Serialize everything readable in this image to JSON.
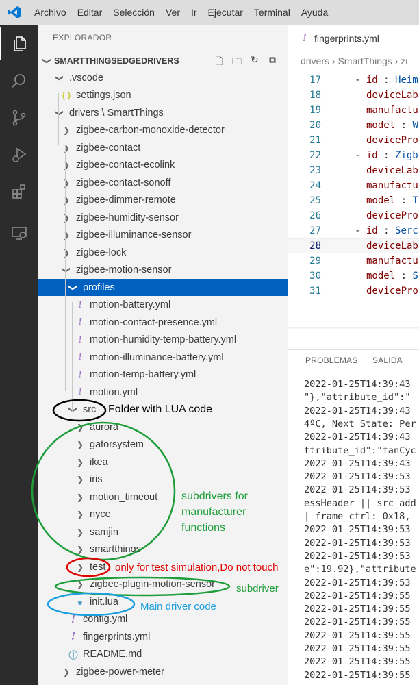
{
  "menu": {
    "items": [
      "Archivo",
      "Editar",
      "Selección",
      "Ver",
      "Ir",
      "Ejecutar",
      "Terminal",
      "Ayuda"
    ]
  },
  "activity": [
    "files-icon",
    "search-icon",
    "source-control-icon",
    "run-debug-icon",
    "extensions-icon",
    "remote-explorer-icon"
  ],
  "sidebar": {
    "title": "EXPLORADOR",
    "root": "SMARTTHINGSEDGEDRIVERS",
    "tree": [
      {
        "label": ".vscode",
        "icon": "chevron",
        "open": true,
        "indent": 1
      },
      {
        "label": "settings.json",
        "icon": "json",
        "indent": 2
      },
      {
        "label": "drivers \\ SmartThings",
        "icon": "chevron",
        "open": true,
        "indent": 1
      },
      {
        "label": "zigbee-carbon-monoxide-detector",
        "icon": "chevron",
        "indent": 2
      },
      {
        "label": "zigbee-contact",
        "icon": "chevron",
        "indent": 2
      },
      {
        "label": "zigbee-contact-ecolink",
        "icon": "chevron",
        "indent": 2
      },
      {
        "label": "zigbee-contact-sonoff",
        "icon": "chevron",
        "indent": 2
      },
      {
        "label": "zigbee-dimmer-remote",
        "icon": "chevron",
        "indent": 2
      },
      {
        "label": "zigbee-humidity-sensor",
        "icon": "chevron",
        "indent": 2
      },
      {
        "label": "zigbee-illuminance-sensor",
        "icon": "chevron",
        "indent": 2
      },
      {
        "label": "zigbee-lock",
        "icon": "chevron",
        "indent": 2
      },
      {
        "label": "zigbee-motion-sensor",
        "icon": "chevron",
        "open": true,
        "indent": 2
      },
      {
        "label": "profiles",
        "icon": "chevron",
        "open": true,
        "indent": 3,
        "selected": true
      },
      {
        "label": "motion-battery.yml",
        "icon": "yml",
        "indent": 4
      },
      {
        "label": "motion-contact-presence.yml",
        "icon": "yml",
        "indent": 4
      },
      {
        "label": "motion-humidity-temp-battery.yml",
        "icon": "yml",
        "indent": 4
      },
      {
        "label": "motion-illuminance-battery.yml",
        "icon": "yml",
        "indent": 4
      },
      {
        "label": "motion-temp-battery.yml",
        "icon": "yml",
        "indent": 4
      },
      {
        "label": "motion.yml",
        "icon": "yml",
        "indent": 4
      },
      {
        "label": "src",
        "icon": "chevron",
        "open": true,
        "indent": 3
      },
      {
        "label": "aurora",
        "icon": "chevron",
        "indent": 4
      },
      {
        "label": "gatorsystem",
        "icon": "chevron",
        "indent": 4
      },
      {
        "label": "ikea",
        "icon": "chevron",
        "indent": 4
      },
      {
        "label": "iris",
        "icon": "chevron",
        "indent": 4
      },
      {
        "label": "motion_timeout",
        "icon": "chevron",
        "indent": 4
      },
      {
        "label": "nyce",
        "icon": "chevron",
        "indent": 4
      },
      {
        "label": "samjin",
        "icon": "chevron",
        "indent": 4
      },
      {
        "label": "smartthings",
        "icon": "chevron",
        "indent": 4
      },
      {
        "label": "test",
        "icon": "chevron",
        "indent": 4
      },
      {
        "label": "zigbee-plugin-motion-sensor",
        "icon": "chevron",
        "indent": 4
      },
      {
        "label": "init.lua",
        "icon": "lua",
        "indent": 4
      },
      {
        "label": "config.yml",
        "icon": "yml",
        "indent": 3
      },
      {
        "label": "fingerprints.yml",
        "icon": "yml",
        "indent": 3
      },
      {
        "label": "README.md",
        "icon": "info",
        "indent": 3
      },
      {
        "label": "zigbee-power-meter",
        "icon": "chevron",
        "indent": 2
      }
    ]
  },
  "editor": {
    "tab_label": "fingerprints.yml",
    "breadcrumb": "drivers › SmartThings › zi",
    "lines": [
      {
        "n": "17",
        "text": "- id : Heim",
        "dash": true
      },
      {
        "n": "18",
        "text": "deviceLab"
      },
      {
        "n": "19",
        "text": "manufactu"
      },
      {
        "n": "20",
        "text": "model : W"
      },
      {
        "n": "21",
        "text": "devicePro"
      },
      {
        "n": "22",
        "text": "- id : Zigb",
        "dash": true
      },
      {
        "n": "23",
        "text": "deviceLab"
      },
      {
        "n": "24",
        "text": "manufactu"
      },
      {
        "n": "25",
        "text": "model : T"
      },
      {
        "n": "26",
        "text": "devicePro"
      },
      {
        "n": "27",
        "text": "- id : Serc",
        "dash": true
      },
      {
        "n": "28",
        "text": "deviceLab",
        "current": true
      },
      {
        "n": "29",
        "text": "manufactu"
      },
      {
        "n": "30",
        "text": "model : S"
      },
      {
        "n": "31",
        "text": "devicePro"
      }
    ]
  },
  "panel": {
    "tabs": [
      "PROBLEMAS",
      "SALIDA"
    ],
    "log": [
      "2022-01-25T14:39:43",
      "\"},\"attribute_id\":\"",
      "2022-01-25T14:39:43",
      "4ºC, Next State: Per",
      "2022-01-25T14:39:43",
      "ttribute_id\":\"fanCyc",
      "2022-01-25T14:39:43",
      "2022-01-25T14:39:53",
      "2022-01-25T14:39:53",
      "essHeader || src_add",
      "| frame_ctrl: 0x18,",
      "2022-01-25T14:39:53",
      "2022-01-25T14:39:53",
      "2022-01-25T14:39:53",
      "e\":19.92},\"attribute",
      "2022-01-25T14:39:53",
      "2022-01-25T14:39:55",
      "2022-01-25T14:39:55",
      "2022-01-25T14:39:55",
      "2022-01-25T14:39:55",
      "2022-01-25T14:39:55",
      "2022-01-25T14:39:55",
      "2022-01-25T14:39:55"
    ]
  },
  "annotations": {
    "src_note": "Folder with LUA code",
    "subdrivers_note": [
      "subdrivers for",
      "manufacturer",
      "functions"
    ],
    "test_note": "only for test simulation,Do not touch",
    "plugin_note": "subdriver",
    "init_note": "Main driver code"
  },
  "colors": {
    "selection": "#0060c0",
    "annotation_black": "#000000",
    "annotation_green": "#1e9e3a",
    "annotation_red": "#e00000",
    "annotation_blue": "#1a9ee0"
  }
}
